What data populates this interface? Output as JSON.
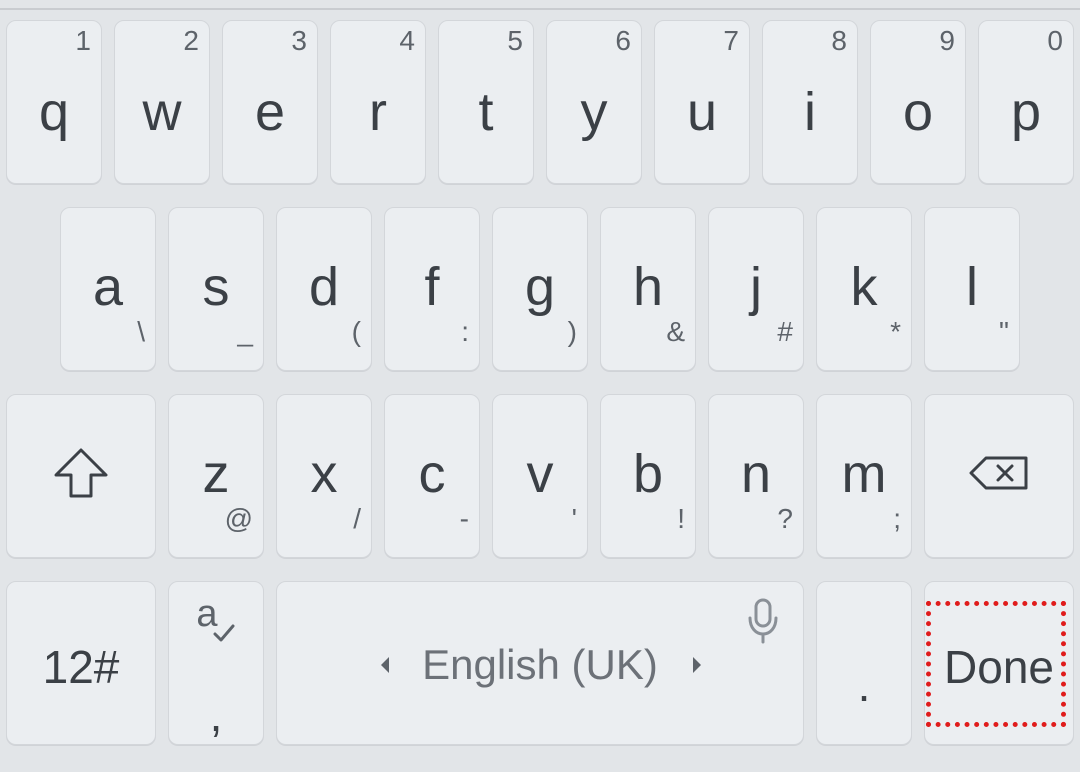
{
  "keyboard": {
    "row1": [
      {
        "letter": "q",
        "hint": "1"
      },
      {
        "letter": "w",
        "hint": "2"
      },
      {
        "letter": "e",
        "hint": "3"
      },
      {
        "letter": "r",
        "hint": "4"
      },
      {
        "letter": "t",
        "hint": "5"
      },
      {
        "letter": "y",
        "hint": "6"
      },
      {
        "letter": "u",
        "hint": "7"
      },
      {
        "letter": "i",
        "hint": "8"
      },
      {
        "letter": "o",
        "hint": "9"
      },
      {
        "letter": "p",
        "hint": "0"
      }
    ],
    "row2": [
      {
        "letter": "a",
        "hint": "\\"
      },
      {
        "letter": "s",
        "hint": "_"
      },
      {
        "letter": "d",
        "hint": "("
      },
      {
        "letter": "f",
        "hint": ":"
      },
      {
        "letter": "g",
        "hint": ")"
      },
      {
        "letter": "h",
        "hint": "&"
      },
      {
        "letter": "j",
        "hint": "#"
      },
      {
        "letter": "k",
        "hint": "*"
      },
      {
        "letter": "l",
        "hint": "\""
      }
    ],
    "row3": [
      {
        "letter": "z",
        "hint": "@"
      },
      {
        "letter": "x",
        "hint": "/"
      },
      {
        "letter": "c",
        "hint": "-"
      },
      {
        "letter": "v",
        "hint": "'"
      },
      {
        "letter": "b",
        "hint": "!"
      },
      {
        "letter": "n",
        "hint": "?"
      },
      {
        "letter": "m",
        "hint": ";"
      }
    ],
    "shift_icon": "shift-arrow-icon",
    "backspace_icon": "backspace-icon",
    "bottom": {
      "symbols_label": "12#",
      "autocorrect_icon": "spellcheck-icon",
      "comma_label": ",",
      "space_label": "English (UK)",
      "mic_icon": "microphone-icon",
      "left_arrow_icon": "triangle-left-icon",
      "right_arrow_icon": "triangle-right-icon",
      "period_label": ".",
      "done_label": "Done"
    },
    "highlight_color": "#e01c1c"
  }
}
